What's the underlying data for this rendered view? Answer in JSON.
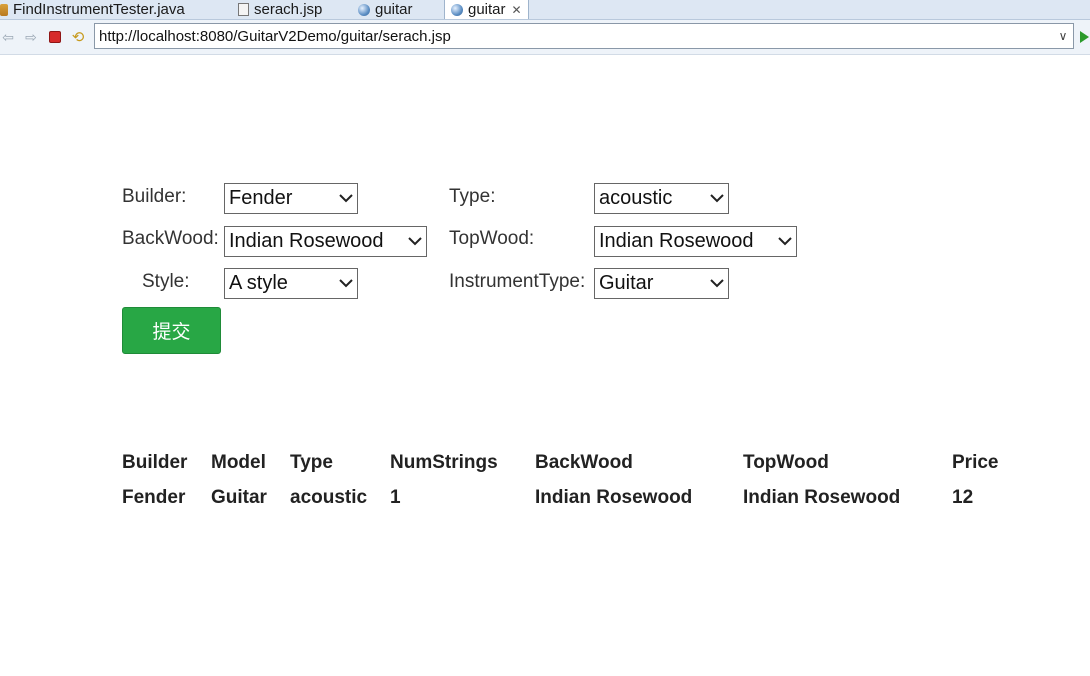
{
  "tabs": [
    {
      "label": "FindInstrumentTester.java",
      "icon": "java-file-icon"
    },
    {
      "label": "serach.jsp",
      "icon": "jsp-file-icon"
    },
    {
      "label": "guitar",
      "icon": "globe-icon"
    },
    {
      "label": "guitar",
      "icon": "globe-icon",
      "active": true
    }
  ],
  "browser": {
    "url": "http://localhost:8080/GuitarV2Demo/guitar/serach.jsp"
  },
  "form": {
    "builder_label": "Builder:",
    "builder_value": "Fender",
    "type_label": "Type:",
    "type_value": "acoustic",
    "backwood_label": "BackWood:",
    "backwood_value": "Indian Rosewood",
    "topwood_label": "TopWood:",
    "topwood_value": "Indian Rosewood",
    "style_label": "Style:",
    "style_value": "A style",
    "instrumenttype_label": "InstrumentType:",
    "instrumenttype_value": "Guitar",
    "submit_label": "提交"
  },
  "results": {
    "headers": [
      "Builder",
      "Model",
      "Type",
      "NumStrings",
      "BackWood",
      "TopWood",
      "Price"
    ],
    "rows": [
      [
        "Fender",
        "Guitar",
        "acoustic",
        "1",
        "Indian Rosewood",
        "Indian Rosewood",
        "12"
      ]
    ]
  },
  "colors": {
    "submit_bg": "#28a745",
    "tab_strip": "#dde7f3"
  }
}
